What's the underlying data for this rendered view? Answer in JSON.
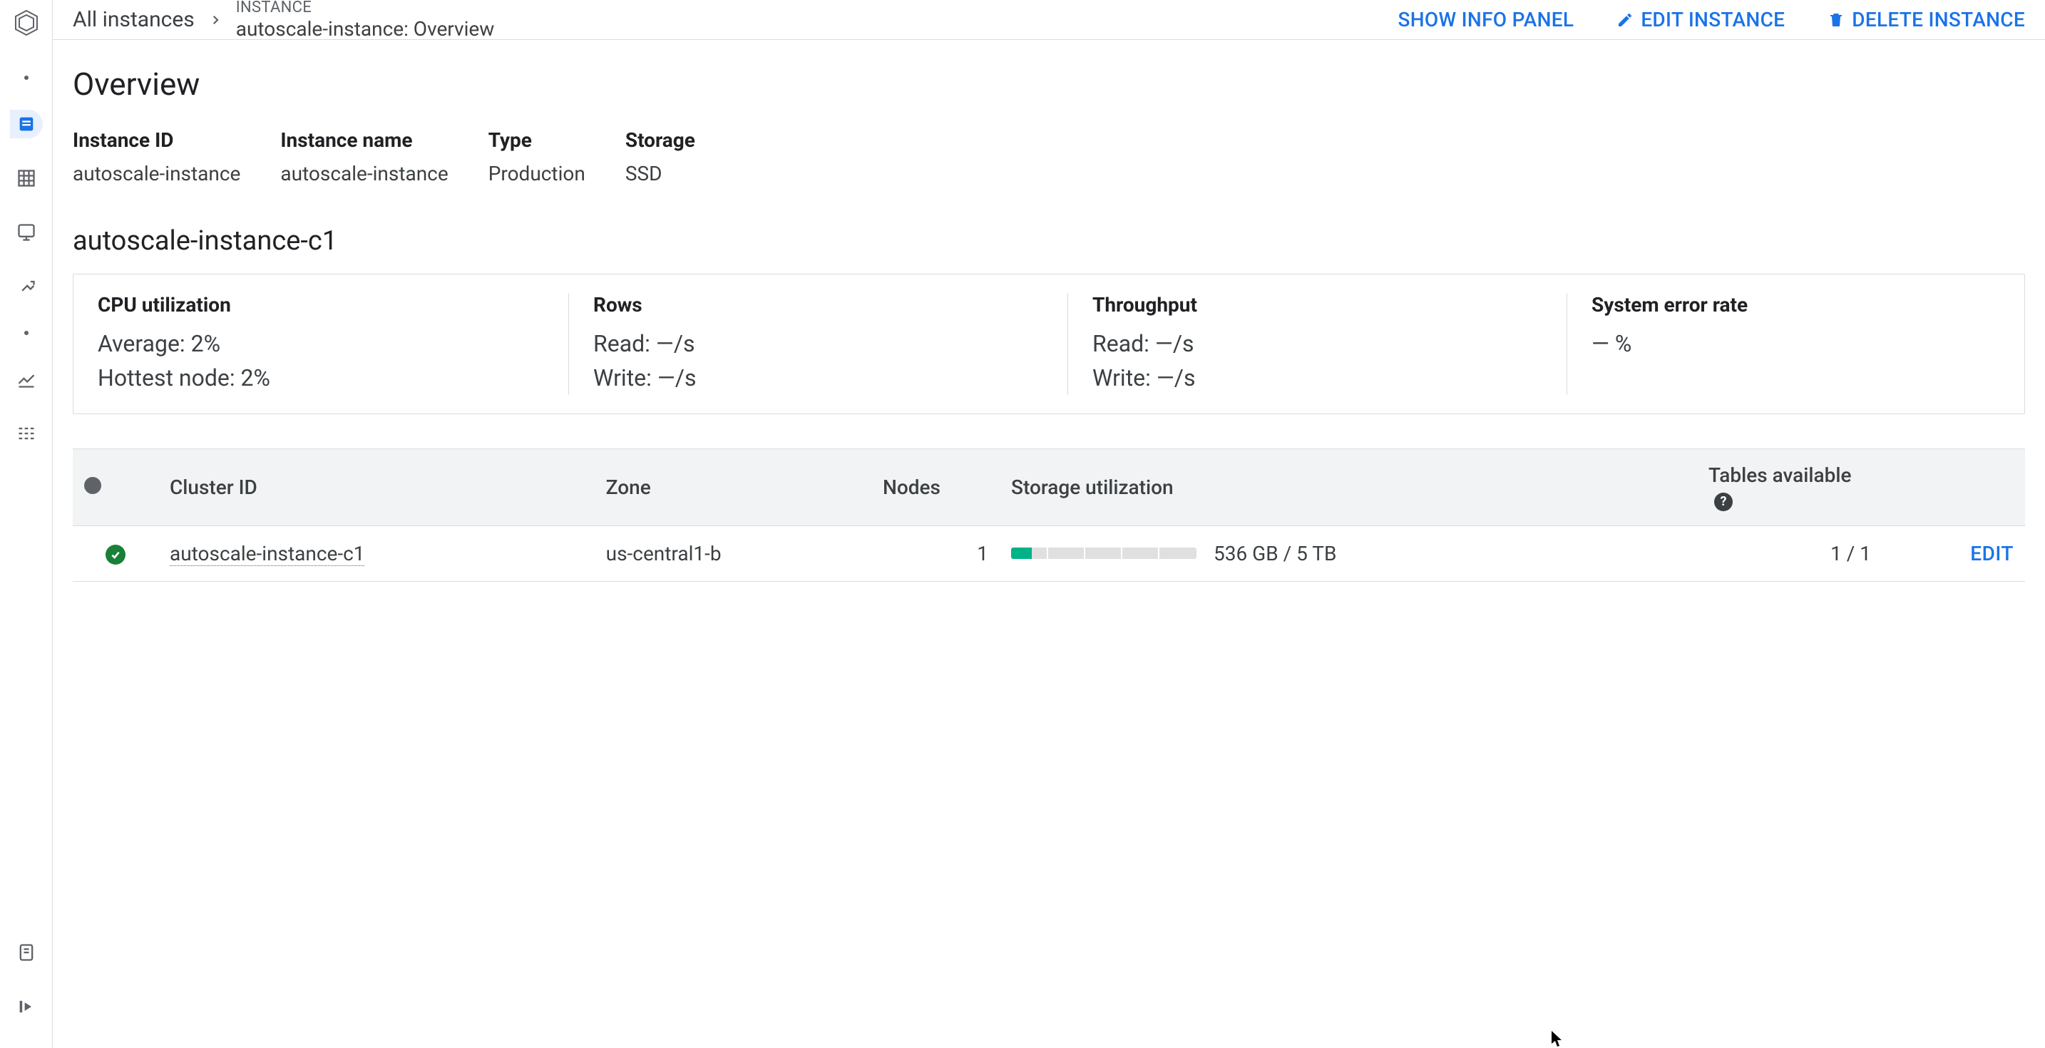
{
  "breadcrumb": {
    "root": "All instances",
    "label": "INSTANCE",
    "title": "autoscale-instance: Overview"
  },
  "actions": {
    "show_info": "SHOW INFO PANEL",
    "edit": "EDIT INSTANCE",
    "delete": "DELETE INSTANCE"
  },
  "page_title": "Overview",
  "meta": [
    {
      "label": "Instance ID",
      "value": "autoscale-instance"
    },
    {
      "label": "Instance name",
      "value": "autoscale-instance"
    },
    {
      "label": "Type",
      "value": "Production"
    },
    {
      "label": "Storage",
      "value": "SSD"
    }
  ],
  "cluster_title": "autoscale-instance-c1",
  "stats": {
    "cpu": {
      "title": "CPU utilization",
      "lines": [
        "Average: 2%",
        "Hottest node: 2%"
      ]
    },
    "rows": {
      "title": "Rows",
      "lines": [
        "Read: —/s",
        "Write: —/s"
      ]
    },
    "thr": {
      "title": "Throughput",
      "lines": [
        "Read: —/s",
        "Write: —/s"
      ]
    },
    "err": {
      "title": "System error rate",
      "lines": [
        "— %"
      ]
    }
  },
  "table": {
    "headers": {
      "cluster": "Cluster ID",
      "zone": "Zone",
      "nodes": "Nodes",
      "storage": "Storage utilization",
      "tables": "Tables available"
    },
    "row": {
      "cluster_id": "autoscale-instance-c1",
      "zone": "us-central1-b",
      "nodes": "1",
      "storage_text": "536 GB / 5 TB",
      "storage_pct": 11,
      "tables": "1 / 1",
      "edit": "EDIT"
    }
  },
  "colors": {
    "primary": "#1a73e8",
    "green": "#188038",
    "teal": "#00b386"
  }
}
